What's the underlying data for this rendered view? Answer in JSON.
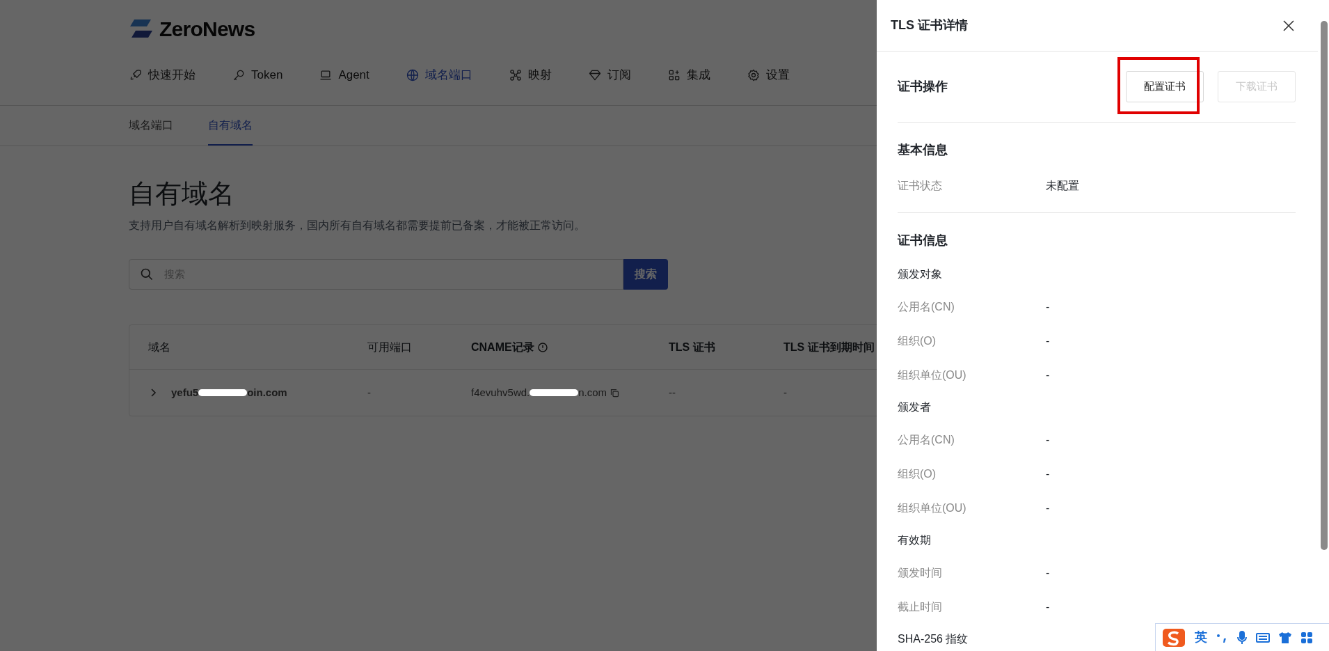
{
  "logo": {
    "text": "ZeroNews"
  },
  "nav": [
    {
      "label": "快速开始",
      "selected": false
    },
    {
      "label": "Token",
      "selected": false
    },
    {
      "label": "Agent",
      "selected": false
    },
    {
      "label": "域名端口",
      "selected": true
    },
    {
      "label": "映射",
      "selected": false
    },
    {
      "label": "订阅",
      "selected": false
    },
    {
      "label": "集成",
      "selected": false
    },
    {
      "label": "设置",
      "selected": false
    }
  ],
  "subtabs": [
    {
      "label": "域名端口",
      "selected": false
    },
    {
      "label": "自有域名",
      "selected": true
    }
  ],
  "page": {
    "title": "自有域名",
    "description": "支持用户自有域名解析到映射服务，国内所有自有域名都需要提前已备案，才能被正常访问。"
  },
  "search": {
    "placeholder": "搜索",
    "button": "搜索"
  },
  "table": {
    "columns": [
      "域名",
      "可用端口",
      "CNAME记录",
      "TLS 证书",
      "TLS 证书到期时间"
    ],
    "rows": [
      {
        "expanded": false,
        "domain": [
          "yefu5",
          "oin.com"
        ],
        "ports": "-",
        "cname": [
          "f4evuhv5wd.",
          "n.com"
        ],
        "tls": "--",
        "expiry": "-"
      }
    ]
  },
  "drawer": {
    "title": "TLS 证书详情",
    "actions_label": "证书操作",
    "buttons": [
      {
        "label": "配置证书",
        "disabled": false,
        "highlighted": true
      },
      {
        "label": "下载证书",
        "disabled": true,
        "highlighted": false
      }
    ],
    "sections": [
      {
        "kind": "heading",
        "text": "基本信息"
      },
      {
        "kind": "field",
        "label": "证书状态",
        "value": "未配置"
      },
      {
        "kind": "divider"
      },
      {
        "kind": "heading",
        "text": "证书信息"
      },
      {
        "kind": "subheading",
        "text": "颁发对象"
      },
      {
        "kind": "field",
        "label": "公用名(CN)",
        "value": "-"
      },
      {
        "kind": "field",
        "label": "组织(O)",
        "value": "-"
      },
      {
        "kind": "field",
        "label": "组织单位(OU)",
        "value": "-"
      },
      {
        "kind": "subheading",
        "text": "颁发者"
      },
      {
        "kind": "field",
        "label": "公用名(CN)",
        "value": "-"
      },
      {
        "kind": "field",
        "label": "组织(O)",
        "value": "-"
      },
      {
        "kind": "field",
        "label": "组织单位(OU)",
        "value": "-"
      },
      {
        "kind": "subheading",
        "text": "有效期"
      },
      {
        "kind": "field",
        "label": "颁发时间",
        "value": "-"
      },
      {
        "kind": "field",
        "label": "截止时间",
        "value": "-"
      },
      {
        "kind": "subheading",
        "text": "SHA-256 指纹"
      }
    ]
  },
  "ime_toolbar": {
    "mode": "英"
  }
}
